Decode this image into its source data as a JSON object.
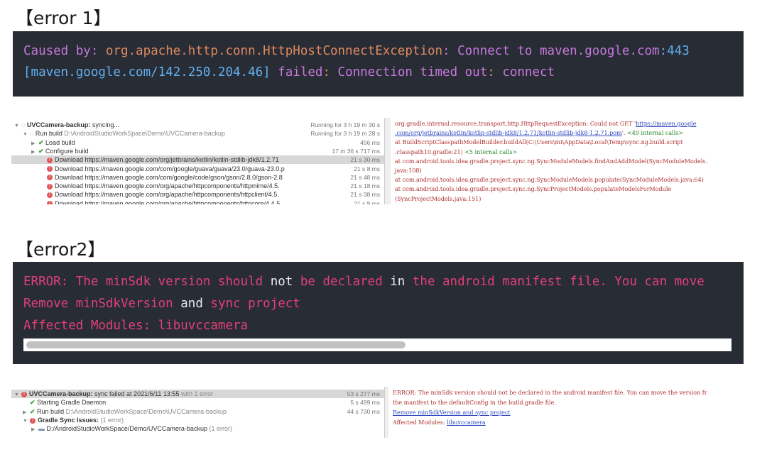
{
  "section1": {
    "heading": "【error 1】",
    "line1": [
      {
        "t": "Caused by: ",
        "c": "purple"
      },
      {
        "t": "org.apache.http.conn.HttpHostConnectException",
        "c": "orange"
      },
      {
        "t": ": ",
        "c": "purple"
      },
      {
        "t": "Connect to ",
        "c": "purple"
      },
      {
        "t": "maven.google.com",
        "c": "purple"
      },
      {
        "t": ":443",
        "c": "blue"
      }
    ],
    "line2": [
      {
        "t": "[maven.google.com/142.250.204.46]",
        "c": "blue"
      },
      {
        "t": " failed",
        "c": "purple"
      },
      {
        "t": ": ",
        "c": "orange"
      },
      {
        "t": "Connection timed out",
        "c": "purple"
      },
      {
        "t": ": ",
        "c": "orange"
      },
      {
        "t": "connect",
        "c": "purple"
      }
    ]
  },
  "screenshot1": {
    "tree": [
      {
        "indent": 0,
        "arrow": "▼",
        "icon": "spin",
        "bold": "UVCCamera-backup:",
        "text": " syncing...",
        "time": "Running for 3 h 19 m 30 s"
      },
      {
        "indent": 1,
        "arrow": "▼",
        "icon": "spin",
        "bold": "",
        "text": "Run build ",
        "muted": "D:\\AndroidStudioWorkSpace\\Demo\\UVCCamera-backup",
        "time": "Running for 3 h 19 m 28 s"
      },
      {
        "indent": 2,
        "arrow": "▶",
        "icon": "check",
        "bold": "",
        "text": "Load build",
        "time": "456 ms"
      },
      {
        "indent": 2,
        "arrow": "▶",
        "icon": "check",
        "bold": "",
        "text": "Configure build",
        "time": "17 m 36 s 717 ms"
      },
      {
        "indent": 3,
        "arrow": "",
        "icon": "error",
        "bold": "",
        "text": "Download https://maven.google.com/org/jetbrains/kotlin/kotlin-stdlib-jdk8/1.2.71",
        "time": "21 s 30 ms",
        "selected": true
      },
      {
        "indent": 3,
        "arrow": "",
        "icon": "error",
        "bold": "",
        "text": "Download https://maven.google.com/com/google/guava/guava/23.0/guava-23.0.p",
        "time": "21 s 8 ms"
      },
      {
        "indent": 3,
        "arrow": "",
        "icon": "error",
        "bold": "",
        "text": "Download https://maven.google.com/com/google/code/gson/gson/2.8.0/gson-2.8",
        "time": "21 s 48 ms"
      },
      {
        "indent": 3,
        "arrow": "",
        "icon": "error",
        "bold": "",
        "text": "Download https://maven.google.com/org/apache/httpcomponents/httpmime/4.5.",
        "time": "21 s 18 ms"
      },
      {
        "indent": 3,
        "arrow": "",
        "icon": "error",
        "bold": "",
        "text": "Download https://maven.google.com/org/apache/httpcomponents/httpclient/4.5.",
        "time": "21 s 38 ms"
      },
      {
        "indent": 3,
        "arrow": "",
        "icon": "error",
        "bold": "",
        "text": "Download https://maven.google.com/org/apache/httpcomponents/httpcore/4.4.5",
        "time": "21 s 8 ms"
      }
    ],
    "log": [
      [
        {
          "t": "org.gradle.internal.resource.transport.http.HttpRequestException: Could not GET '",
          "c": ""
        },
        {
          "t": "https://maven.google",
          "c": "link"
        }
      ],
      [
        {
          "t": ".com/org/jetbrains/kotlin/kotlin-stdlib-jdk8/1.2.71/kotlin-stdlib-jdk8-1.2.71.pom",
          "c": "link"
        },
        {
          "t": "'. ",
          "c": ""
        },
        {
          "t": "<49 internal calls>",
          "c": "g"
        }
      ],
      [
        {
          "t": "        at BuildScriptClasspathModelBuilder.buildAll(C:\\Users\\mi\\AppData\\Local\\Temp\\sync.ng.build.script",
          "c": ""
        }
      ],
      [
        {
          "t": ".classpath10.gradle:21) ",
          "c": ""
        },
        {
          "t": "<5 internal calls>",
          "c": "g"
        }
      ],
      [
        {
          "t": "        at com.android.tools.idea.gradle.project.sync.ng.SyncModuleModels.findAndAddModel(SyncModuleModels.",
          "c": ""
        }
      ],
      [
        {
          "t": "java:108)",
          "c": ""
        }
      ],
      [
        {
          "t": "        at com.android.tools.idea.gradle.project.sync.ng.SyncModuleModels.populate(SyncModuleModels.java:64)",
          "c": ""
        }
      ],
      [
        {
          "t": "        at com.android.tools.idea.gradle.project.sync.ng.SyncProjectModels.populateModelsForModule",
          "c": ""
        }
      ],
      [
        {
          "t": "(SyncProjectModels.java:151)",
          "c": ""
        }
      ]
    ]
  },
  "section2": {
    "heading": "【error2】",
    "line1": [
      {
        "t": "ERROR: The minSdk version should ",
        "c": "red"
      },
      {
        "t": "not",
        "c": "white"
      },
      {
        "t": " be declared ",
        "c": "red"
      },
      {
        "t": "in",
        "c": "white"
      },
      {
        "t": " the android manifest file. You can move",
        "c": "red"
      }
    ],
    "line2": [
      {
        "t": "Remove minSdkVersion ",
        "c": "red"
      },
      {
        "t": "and",
        "c": "white"
      },
      {
        "t": " sync project",
        "c": "red"
      }
    ],
    "line3": [
      {
        "t": "Affected Modules: libuvccamera",
        "c": "red"
      }
    ],
    "scroll_fraction": 0.54
  },
  "screenshot2": {
    "tree": [
      {
        "indent": 0,
        "arrow": "▼",
        "icon": "error",
        "bold": "UVCCamera-backup:",
        "text": " sync failed at 2021/6/11 13:55",
        "muted": " with 1 error",
        "time": "53 s 277 ms",
        "selected": true
      },
      {
        "indent": 1,
        "arrow": "",
        "icon": "check",
        "bold": "",
        "text": "Starting Gradle Daemon",
        "time": "5 s 499 ms"
      },
      {
        "indent": 1,
        "arrow": "▶",
        "icon": "check",
        "bold": "",
        "text": "Run build ",
        "muted": "D:\\AndroidStudioWorkSpace\\Demo\\UVCCamera-backup",
        "time": "44 s 730 ms"
      },
      {
        "indent": 1,
        "arrow": "▼",
        "icon": "error",
        "bold": "Gradle Sync Issues:",
        "text": "",
        "muted": " (1 error)",
        "time": ""
      },
      {
        "indent": 2,
        "arrow": "▶",
        "icon": "folder",
        "bold": "",
        "text": "D:/AndroidStudioWorkSpace/Demo/UVCCamera-backup",
        "muted": " (1 error)",
        "time": ""
      }
    ],
    "log": [
      [
        {
          "t": "ERROR: The minSdk version should not be declared in the android manifest file. You can move the version fr",
          "c": ""
        }
      ],
      [
        {
          "t": "  the manifest to the defaultConfig in the build.gradle file.",
          "c": ""
        }
      ],
      [
        {
          "t": "Remove minSdkVersion and sync project",
          "c": "link"
        }
      ],
      [
        {
          "t": "Affected Modules: ",
          "c": ""
        },
        {
          "t": "libuvccamera",
          "c": "link"
        }
      ]
    ]
  }
}
